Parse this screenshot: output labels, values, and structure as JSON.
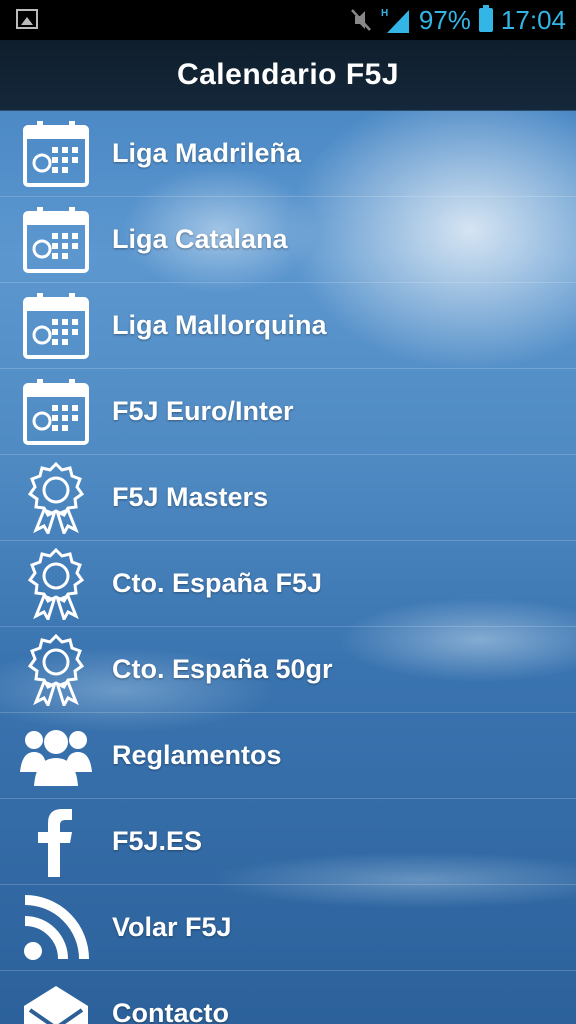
{
  "status_bar": {
    "battery_percent": "97%",
    "time": "17:04",
    "network_type": "H",
    "icons": [
      "image-icon",
      "mute-icon",
      "signal-icon",
      "battery-icon"
    ]
  },
  "header": {
    "title": "Calendario F5J"
  },
  "menu": {
    "items": [
      {
        "label": "Liga Madrileña",
        "icon": "calendar-icon"
      },
      {
        "label": "Liga Catalana",
        "icon": "calendar-icon"
      },
      {
        "label": "Liga Mallorquina",
        "icon": "calendar-icon"
      },
      {
        "label": "F5J Euro/Inter",
        "icon": "calendar-icon"
      },
      {
        "label": "F5J Masters",
        "icon": "award-icon"
      },
      {
        "label": "Cto. España F5J",
        "icon": "award-icon"
      },
      {
        "label": "Cto. España 50gr",
        "icon": "award-icon"
      },
      {
        "label": "Reglamentos",
        "icon": "group-icon"
      },
      {
        "label": "F5J.ES",
        "icon": "facebook-icon"
      },
      {
        "label": "Volar F5J",
        "icon": "rss-icon"
      },
      {
        "label": "Contacto",
        "icon": "mail-icon"
      }
    ]
  },
  "colors": {
    "status_accent": "#33b5e5",
    "title_bar": "#15273a",
    "text": "#ffffff"
  }
}
